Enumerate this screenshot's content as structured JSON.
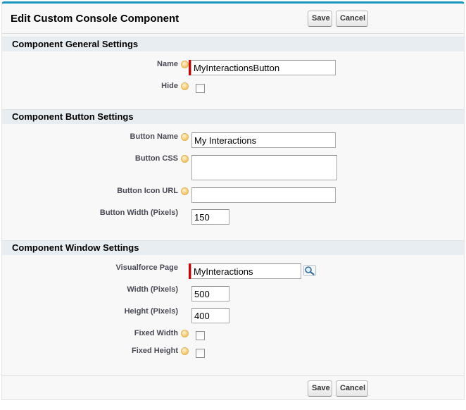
{
  "header": {
    "title": "Edit Custom Console Component",
    "save_label": "Save",
    "cancel_label": "Cancel"
  },
  "sections": {
    "general": {
      "title": "Component General Settings",
      "name_label": "Name",
      "name_value": "MyInteractionsButton",
      "hide_label": "Hide"
    },
    "button": {
      "title": "Component Button Settings",
      "button_name_label": "Button Name",
      "button_name_value": "My Interactions",
      "button_css_label": "Button CSS",
      "button_css_value": "",
      "button_icon_url_label": "Button Icon URL",
      "button_icon_url_value": "",
      "button_width_label": "Button Width (Pixels)",
      "button_width_value": "150"
    },
    "window": {
      "title": "Component Window Settings",
      "visualforce_page_label": "Visualforce Page",
      "visualforce_page_value": "MyInteractions",
      "width_label": "Width (Pixels)",
      "width_value": "500",
      "height_label": "Height (Pixels)",
      "height_value": "400",
      "fixed_width_label": "Fixed Width",
      "fixed_height_label": "Fixed Height"
    }
  },
  "footer": {
    "save_label": "Save",
    "cancel_label": "Cancel"
  },
  "icons": {
    "help": "help-icon",
    "lookup": "lookup-magnifier-icon"
  },
  "colors": {
    "accent_top_border": "#1797c0",
    "required_marker": "#cc0000",
    "section_header_bg": "#e8edf2"
  }
}
